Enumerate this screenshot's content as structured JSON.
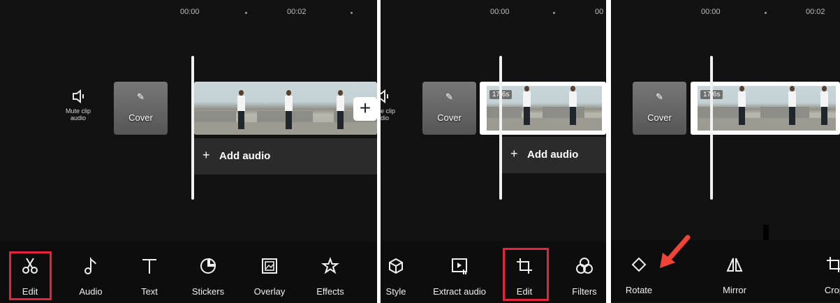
{
  "colors": {
    "highlight": "#e0263a",
    "arrow": "#f04438",
    "background": "#121212"
  },
  "panel1": {
    "timecodes": [
      "00:00",
      "00:02"
    ],
    "mute_clip": {
      "icon": "speaker-icon",
      "line1": "Mute clip",
      "line2": "audio"
    },
    "cover_label": "Cover",
    "add_audio": "Add audio",
    "plus": "+",
    "toolbar": [
      {
        "label": "Edit",
        "icon": "scissors-icon",
        "highlighted": true
      },
      {
        "label": "Audio",
        "icon": "music-note-icon"
      },
      {
        "label": "Text",
        "icon": "text-icon"
      },
      {
        "label": "Stickers",
        "icon": "sticker-icon"
      },
      {
        "label": "Overlay",
        "icon": "overlay-icon"
      },
      {
        "label": "Effects",
        "icon": "effects-star-icon"
      }
    ]
  },
  "panel2": {
    "timecodes": [
      "00:00",
      "00"
    ],
    "mute_clip": {
      "line1": "e clip",
      "line2": "dio"
    },
    "cover_label": "Cover",
    "duration": "17.6s",
    "add_audio": "Add audio",
    "toolbar": [
      {
        "label": "Style",
        "icon": "cube-icon"
      },
      {
        "label": "Extract audio",
        "icon": "extract-audio-icon"
      },
      {
        "label": "Edit",
        "icon": "crop-icon",
        "highlighted": true
      },
      {
        "label": "Filters",
        "icon": "filters-icon"
      }
    ]
  },
  "panel3": {
    "timecodes": [
      "00:00",
      "00:02"
    ],
    "cover_label": "Cover",
    "duration": "17.6s",
    "toolbar": [
      {
        "label": "Rotate",
        "icon": "rotate-icon"
      },
      {
        "label": "Mirror",
        "icon": "mirror-icon"
      },
      {
        "label": "Crop",
        "icon": "crop-icon",
        "display": "Crop"
      }
    ]
  }
}
